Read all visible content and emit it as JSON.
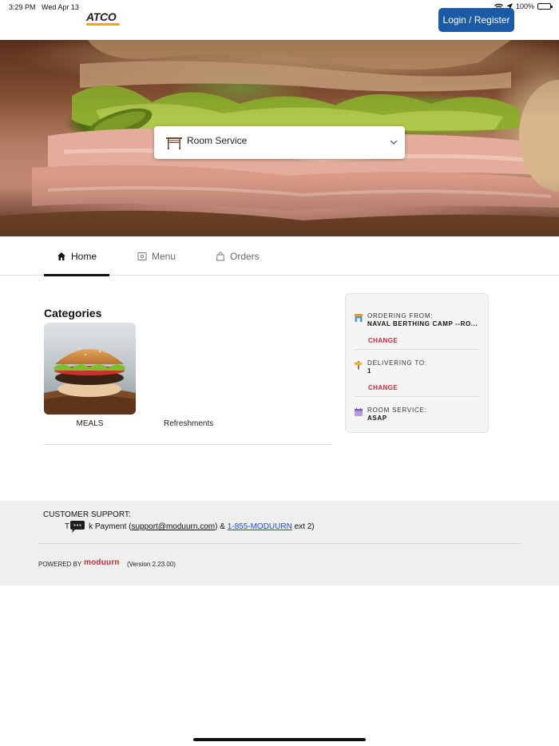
{
  "status_bar": {
    "time": "3:29 PM",
    "date": "Wed Apr 13",
    "battery": "100%",
    "icons": [
      "wifi-icon",
      "location-icon",
      "battery-icon"
    ]
  },
  "header": {
    "logo_text": "ATCO",
    "login_label": "Login / Register",
    "colors": {
      "login_bg": "#1a5aa6",
      "logo_accent": "#f5a800"
    }
  },
  "hero": {
    "service_selector": {
      "value": "Room Service",
      "icon": "room-service-cart-icon",
      "chevron": "chevron-down-icon"
    }
  },
  "tabs": [
    {
      "label": "Home",
      "icon": "home-icon",
      "active": true
    },
    {
      "label": "Menu",
      "icon": "menu-icon",
      "active": false
    },
    {
      "label": "Orders",
      "icon": "shopping-bag-icon",
      "active": false
    }
  ],
  "categories": {
    "title": "Categories",
    "items": [
      {
        "label": "MEALS",
        "image": "burger-image"
      },
      {
        "label": "Refreshments"
      }
    ]
  },
  "order_info": {
    "ordering_from": {
      "label": "ORDERING FROM:",
      "value": "NAVAL BERTHING CAMP --RO...",
      "change": "CHANGE"
    },
    "delivering_to": {
      "label": "DELIVERING TO:",
      "value": "1",
      "change": "CHANGE"
    },
    "room_service": {
      "label": "ROOM SERVICE:",
      "value": "ASAP"
    },
    "colors": {
      "change": "#d4233a"
    }
  },
  "footer": {
    "support_title": "CUSTOMER SUPPORT:",
    "support_prefix": "T",
    "support_text": "k Payment (",
    "support_email": "support@moduurn.com",
    "support_amp": ") & ",
    "support_phone": "1-855-MODUURN",
    "support_ext": " ext 2)",
    "powered_by": "POWERED BY",
    "brand": "moduurn",
    "version": "(Version 2.23.00)"
  }
}
